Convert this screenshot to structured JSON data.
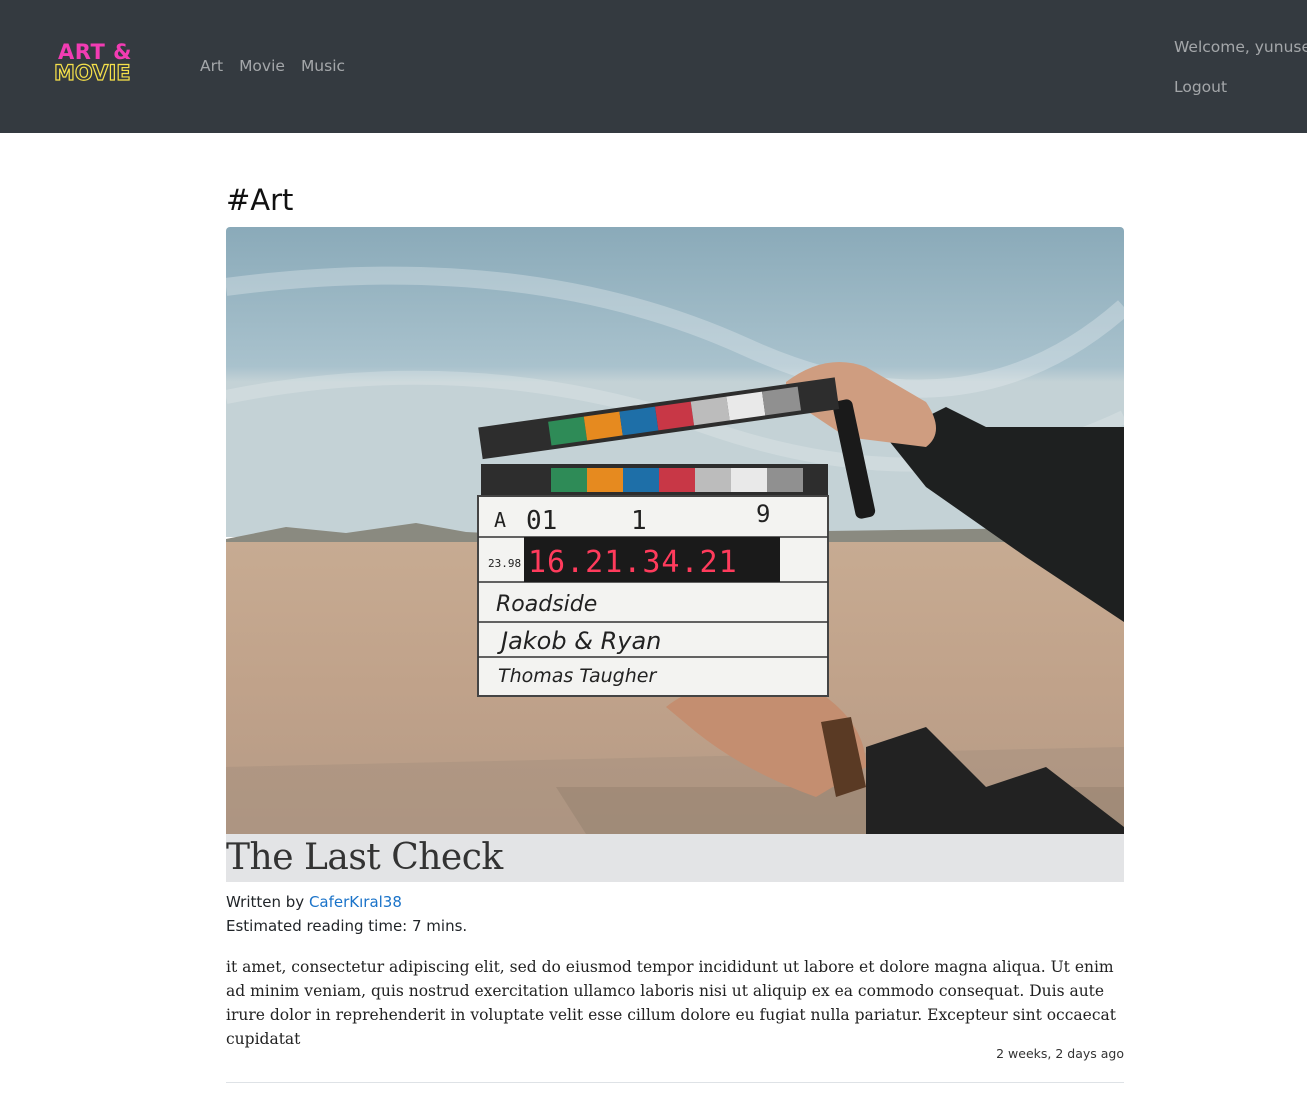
{
  "navbar": {
    "logo": {
      "line1": "ART &",
      "line2": "MOVIE"
    },
    "links": [
      "Art",
      "Movie",
      "Music"
    ],
    "welcome": "Welcome, yunusem",
    "logout": "Logout"
  },
  "post": {
    "category": "#Art",
    "image_icon": "film-clapperboard-photo",
    "clapper": {
      "roll": "A",
      "scene": "01",
      "take_a": "1",
      "take": "9",
      "fps": "23.98",
      "timecode": "16.21.34.21",
      "prod": "Roadside",
      "dir": "Jakob & Ryan",
      "cam": "Thomas Taugher"
    },
    "title": "The Last Check",
    "written_by_prefix": "Written by ",
    "author": "CaferKıral38",
    "reading_time": "Estimated reading time: 7 mins.",
    "excerpt": "it amet, consectetur adipiscing elit, sed do eiusmod tempor incididunt ut labore et dolore magna aliqua. Ut enim ad minim veniam, quis nostrud exercitation ullamco laboris nisi ut aliquip ex ea commodo consequat. Duis aute irure dolor in reprehenderit in voluptate velit esse cillum dolore eu fugiat nulla pariatur. Excepteur sint occaecat cupidatat",
    "timestamp": "2 weeks, 2 days ago"
  },
  "colors": {
    "navbar_bg": "#343a40",
    "logo_pink": "#f23cb3",
    "logo_yellow": "#f5e04a",
    "link_blue": "#1a73c9",
    "title_bar_bg": "#e3e4e6"
  }
}
